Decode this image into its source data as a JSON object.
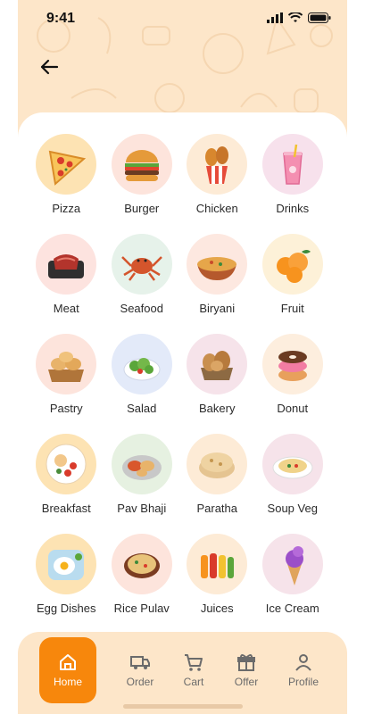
{
  "status_bar": {
    "time": "9:41"
  },
  "colors": {
    "accent": "#f7870c",
    "background": "#fde6c9",
    "card": "#ffffff"
  },
  "categories": [
    {
      "label": "Pizza",
      "icon": "pizza-icon",
      "bg": "#fde3b3"
    },
    {
      "label": "Burger",
      "icon": "burger-icon",
      "bg": "#fde4dc"
    },
    {
      "label": "Chicken",
      "icon": "chicken-icon",
      "bg": "#fdebd6"
    },
    {
      "label": "Drinks",
      "icon": "drinks-icon",
      "bg": "#f7e1ec"
    },
    {
      "label": "Meat",
      "icon": "meat-icon",
      "bg": "#fde3df"
    },
    {
      "label": "Seafood",
      "icon": "seafood-icon",
      "bg": "#e6f2ea"
    },
    {
      "label": "Biryani",
      "icon": "biryani-icon",
      "bg": "#fde8e0"
    },
    {
      "label": "Fruit",
      "icon": "fruit-icon",
      "bg": "#fdf1d8"
    },
    {
      "label": "Pastry",
      "icon": "pastry-icon",
      "bg": "#fde4dc"
    },
    {
      "label": "Salad",
      "icon": "salad-icon",
      "bg": "#e3eaf9"
    },
    {
      "label": "Bakery",
      "icon": "bakery-icon",
      "bg": "#f6e3ea"
    },
    {
      "label": "Donut",
      "icon": "donut-icon",
      "bg": "#fdeede"
    },
    {
      "label": "Breakfast",
      "icon": "breakfast-icon",
      "bg": "#fde3b3"
    },
    {
      "label": "Pav Bhaji",
      "icon": "pav-bhaji-icon",
      "bg": "#e6f1e1"
    },
    {
      "label": "Paratha",
      "icon": "paratha-icon",
      "bg": "#fdebd6"
    },
    {
      "label": "Soup Veg",
      "icon": "soup-icon",
      "bg": "#f6e3ea"
    },
    {
      "label": "Egg Dishes",
      "icon": "egg-icon",
      "bg": "#fde3b3"
    },
    {
      "label": "Rice Pulav",
      "icon": "rice-icon",
      "bg": "#fde4dc"
    },
    {
      "label": "Juices",
      "icon": "juice-icon",
      "bg": "#fdebd6"
    },
    {
      "label": "Ice Cream",
      "icon": "ice-cream-icon",
      "bg": "#f6e3ea"
    }
  ],
  "nav": {
    "home": "Home",
    "order": "Order",
    "cart": "Cart",
    "offer": "Offer",
    "profile": "Profile"
  }
}
